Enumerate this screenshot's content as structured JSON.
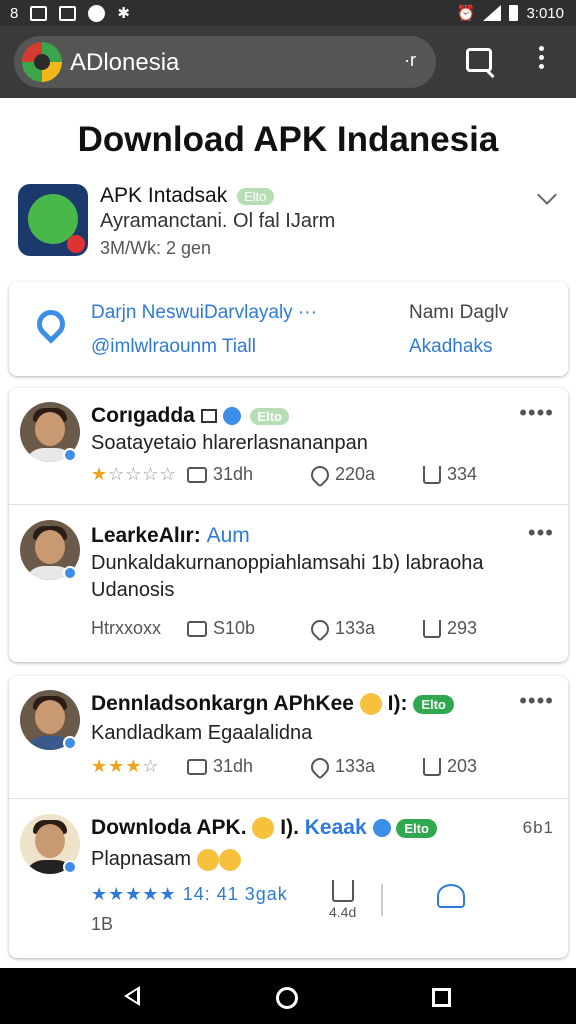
{
  "status_bar": {
    "left_icons": [
      "sim-8",
      "gallery-icon",
      "box-icon",
      "chat-icon",
      "gear-icon"
    ],
    "sim_label": "8",
    "time": "3:010",
    "right_icons": [
      "alarm-icon",
      "wifi-icon",
      "signal-icon",
      "battery-icon"
    ]
  },
  "app_bar": {
    "title": "ADlonesia",
    "arrow": "·r",
    "icons": [
      "search-icon",
      "more-vert-icon"
    ]
  },
  "page": {
    "heading": "Download APK Indanesia"
  },
  "app_info": {
    "name": "APK Intadsak",
    "badge": "Elto",
    "subtitle": "Ayramanctani. Ol fal IJarm",
    "meta": "3M/Wk: 2 gen"
  },
  "info_card": {
    "link1": "Darjn NeswuiDarvlayaly ···",
    "link2": "@imlwlraounm Tiall",
    "right_label": "Namı Daglv",
    "right_link": "Akadhaks"
  },
  "posts": [
    {
      "name": "Corıgadda",
      "badge": "Elto",
      "text": "Soatayetaio hlarerlasnananpan",
      "rating": 1,
      "retweets": "31dh",
      "likes": "220a",
      "shares": "334"
    },
    {
      "name": "LearkeAlır:",
      "name_suffix": "Aum",
      "text": "Dunkaldakurnanoppiahlamsahi 1b) labraoha Udanosis",
      "rating_text": "Htrxxoxx",
      "retweets": "S10b",
      "likes": "133a",
      "shares": "293",
      "more": "•••"
    },
    {
      "name": "Dennladsonkargn APhKee",
      "name_mid": "I):",
      "badge": "Elto",
      "text": "Kandladkam Egaalalidna",
      "rating": 3,
      "retweets": "31dh",
      "likes": "133a",
      "shares": "203"
    },
    {
      "name": "Downloda APK.",
      "name_mid": "I).",
      "keyword": "Keaak",
      "badge": "Elto",
      "text": "Plapnasam",
      "stars_text": "14: 41 3gak",
      "count": "1B",
      "action_label": "4.4d",
      "right_meta": "6b1"
    }
  ],
  "nav_bar": {
    "icons": [
      "back-icon",
      "home-icon",
      "recents-icon"
    ]
  }
}
